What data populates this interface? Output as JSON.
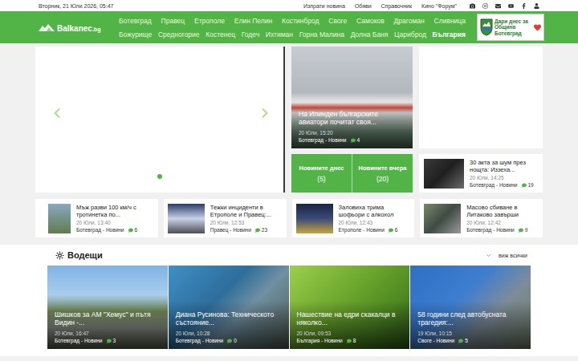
{
  "top_bar": {
    "date": "Вторник, 21 Юли 2026, 05:47",
    "links": [
      "Изпрати новина",
      "Обяви",
      "Справочник",
      "Кино \"Форум\""
    ]
  },
  "header": {
    "logo": {
      "name": "Balkanec",
      "tld": ".bg"
    },
    "nav_rows": [
      [
        {
          "label": "Ботевград",
          "selected": false
        },
        {
          "label": "Правец",
          "selected": false
        },
        {
          "label": "Етрополе",
          "selected": false
        },
        {
          "label": "Елин Пелин",
          "selected": false
        },
        {
          "label": "Костинброд",
          "selected": false
        },
        {
          "label": "Своге",
          "selected": false
        },
        {
          "label": "Самоков",
          "selected": false
        },
        {
          "label": "Драгоман",
          "selected": false
        },
        {
          "label": "Сливница",
          "selected": false
        }
      ],
      [
        {
          "label": "Божурище",
          "selected": false
        },
        {
          "label": "Средногорие",
          "selected": false
        },
        {
          "label": "Костенец",
          "selected": false
        },
        {
          "label": "Годеч",
          "selected": false
        },
        {
          "label": "Ихтиман",
          "selected": false
        },
        {
          "label": "Горна Малина",
          "selected": false
        },
        {
          "label": "Долна Баня",
          "selected": false
        },
        {
          "label": "Цариброд",
          "selected": false
        },
        {
          "label": "България",
          "selected": true
        }
      ]
    ],
    "banner": {
      "text": "Дари днес за Община Ботевград"
    }
  },
  "slider": {
    "dots": [
      {
        "selected": true
      }
    ]
  },
  "featured": {
    "title": "На Илинден българските авиатори почитат своя...",
    "date": "20 Юли, 15:20",
    "category": "Ботевград - Новини",
    "comments": "4"
  },
  "stats": [
    {
      "label": "Новините днес",
      "count": "(5)"
    },
    {
      "label": "Новините вчера",
      "count": "(20)"
    }
  ],
  "side_card": {
    "title": "30 акта за шум през нощта: Иззеха...",
    "date": "20 Юли, 14:25",
    "category": "Ботевград - Новини",
    "comments": "19"
  },
  "news_row": [
    {
      "title": "Мъж разви 100 км/ч с тротинетка по...",
      "date": "20 Юли, 13:40",
      "category": "Ботевград - Новини",
      "comments": "6"
    },
    {
      "title": "Тежки инциденти в Етрополе и Правец:...",
      "date": "20 Юли, 12:53",
      "category": "Правец - Новини",
      "comments": "23"
    },
    {
      "title": "Заловиха трима шофьори с алкохол",
      "date": "20 Юли, 12:43",
      "category": "Етрополе - Новини",
      "comments": "6"
    },
    {
      "title": "Масово сбиване в Литаково завърши",
      "date": "20 Юли, 12:42",
      "category": "Ботевград - Новини",
      "comments": "9"
    }
  ],
  "leading": {
    "title": "Водещи",
    "more": "виж всички",
    "cards": [
      {
        "title": "Шишков за АМ \"Хемус\" и пътя Видин -...",
        "date": "20 Юли, 16:47",
        "category": "Ботевград - Новини",
        "comments": "3"
      },
      {
        "title": "Диана Русинова: Техническото състояние...",
        "date": "20 Юли, 10:28",
        "category": "Ботевград - Новини",
        "comments": "0"
      },
      {
        "title": "Нашествие на едри скакалци в няколко...",
        "date": "20 Юли, 09:53",
        "category": "България - Новини",
        "comments": "8"
      },
      {
        "title": "58 години след автобусната трагедия:...",
        "date": "19 Юли, 10:15",
        "category": "Своге - Новини",
        "comments": "5"
      }
    ]
  }
}
